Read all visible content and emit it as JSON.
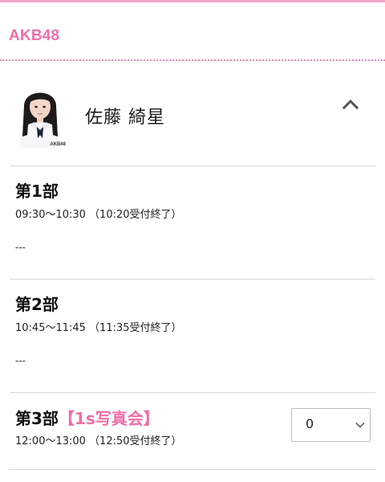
{
  "header": {
    "brand": "AKB48",
    "accent_color": "#ef6fa8"
  },
  "member": {
    "name": "佐藤 綺星",
    "photo_caption": "AKB48",
    "expanded": true,
    "toggle_icon": "chevron-up-icon"
  },
  "sessions": [
    {
      "title": "第1部",
      "tag": "",
      "time": "09:30〜10:30 （10:20受付終了）",
      "status": "---"
    },
    {
      "title": "第2部",
      "tag": "",
      "time": "10:45〜11:45 （11:35受付終了）",
      "status": "---"
    },
    {
      "title": "第3部",
      "tag": "【1s写真会】",
      "time": "12:00〜13:00 （12:50受付終了）",
      "quantity": {
        "value": "0",
        "icon": "chevron-down-icon"
      }
    }
  ]
}
